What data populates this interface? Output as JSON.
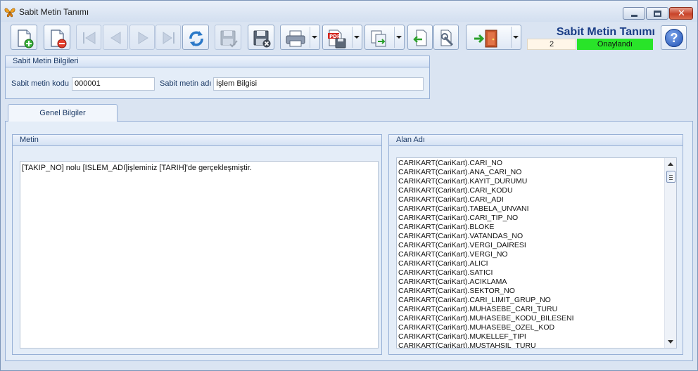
{
  "window": {
    "title": "Sabit Metin Tanımı"
  },
  "record": {
    "title": "Sabit Metin Tanımı",
    "number": "2",
    "status": "Onaylandı",
    "status_color": "#29e429"
  },
  "group_info": {
    "title": "Sabit Metin Bilgileri",
    "code_label": "Sabit metin kodu",
    "code_value": "000001",
    "name_label": "Sabit metin adı",
    "name_value": "İşlem Bilgisi"
  },
  "tabs": [
    {
      "label": "Genel Bilgiler",
      "selected": true
    }
  ],
  "metin": {
    "title": "Metin",
    "text": "[TAKIP_NO] nolu [ISLEM_ADI]işleminiz [TARIH]'de gerçekleşmiştir."
  },
  "alan": {
    "title": "Alan Adı",
    "items": [
      "CARIKART(CariKart).CARI_NO",
      "CARIKART(CariKart).ANA_CARI_NO",
      "CARIKART(CariKart).KAYIT_DURUMU",
      "CARIKART(CariKart).CARI_KODU",
      "CARIKART(CariKart).CARI_ADI",
      "CARIKART(CariKart).TABELA_UNVANI",
      "CARIKART(CariKart).CARI_TIP_NO",
      "CARIKART(CariKart).BLOKE",
      "CARIKART(CariKart).VATANDAS_NO",
      "CARIKART(CariKart).VERGI_DAIRESI",
      "CARIKART(CariKart).VERGI_NO",
      "CARIKART(CariKart).ALICI",
      "CARIKART(CariKart).SATICI",
      "CARIKART(CariKart).ACIKLAMA",
      "CARIKART(CariKart).SEKTOR_NO",
      "CARIKART(CariKart).CARI_LIMIT_GRUP_NO",
      "CARIKART(CariKart).MUHASEBE_CARI_TURU",
      "CARIKART(CariKart).MUHASEBE_KODU_BILESENI",
      "CARIKART(CariKart).MUHASEBE_OZEL_KOD",
      "CARIKART(CariKart).MUKELLEF_TIPI",
      "CARIKART(CariKart).MUSTAHSIL_TURU"
    ]
  },
  "toolbar": {
    "icons": [
      "new-record-icon",
      "delete-record-icon",
      "first-record-icon",
      "previous-record-icon",
      "next-record-icon",
      "last-record-icon",
      "refresh-icon",
      "save-icon",
      "cancel-save-icon",
      "print-icon",
      "pdf-export-icon",
      "copy-icon",
      "import-icon",
      "tools-icon",
      "exit-icon",
      "help-icon"
    ]
  }
}
